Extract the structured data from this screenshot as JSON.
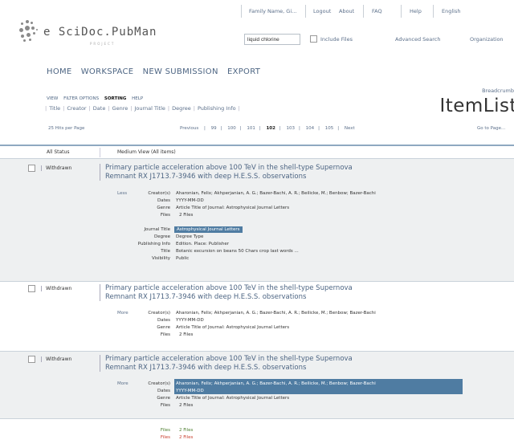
{
  "topbar": {
    "user": "Family Name, Gi...",
    "logout": "Logout",
    "about": "About",
    "faq": "FAQ",
    "help": "Help",
    "language": "English"
  },
  "logo": {
    "text": "e SciDoc.PubMan",
    "sub": "PROJECT"
  },
  "search": {
    "value": "liquid chlorine",
    "include_files": "Include Files",
    "advanced": "Advanced Search",
    "organization": "Organization"
  },
  "mainnav": [
    "HOME",
    "WORKSPACE",
    "NEW SUBMISSION",
    "EXPORT"
  ],
  "submenu": [
    {
      "label": "VIEW",
      "active": false
    },
    {
      "label": "FILTER OPTIONS",
      "active": false
    },
    {
      "label": "SORTING",
      "active": true
    },
    {
      "label": "HELP",
      "active": false
    }
  ],
  "sort_options": [
    "Title",
    "Creator",
    "Date",
    "Genre",
    "Journal Title",
    "Degree",
    "Publishing Info"
  ],
  "breadcrumb": "Breadcrumb",
  "page_title": "ItemList",
  "paging": {
    "hits": "25 Hits per Page",
    "previous": "Previous",
    "pages": [
      "99",
      "100",
      "101",
      "102",
      "103",
      "104",
      "105"
    ],
    "current": "102",
    "next": "Next",
    "goto": "Go to Page..."
  },
  "list_header": {
    "status": "All Status",
    "view": "Medium View (All items)"
  },
  "labels": {
    "creators": "Creator(s)",
    "dates": "Dates",
    "genre": "Genre",
    "files": "Files",
    "journal_title": "Journal Title",
    "degree": "Degree",
    "publishing_info": "Publishing Info",
    "title": "Title",
    "visibility": "Visibility"
  },
  "items": [
    {
      "status": "Withdrawn",
      "title_line1": "Primary particle acceleration above 100 TeV in the shell-type Supernova",
      "title_line2": "Remnant RX J1713.7-3946 with deep H.E.S.S. observations",
      "toggle": "Less",
      "creators": "Aharonian, Felix; Akhperjanian, A. G.; Bazer-Bachi, A. R.; Beilicke, M.; Benbow; Bazer-Bachi",
      "dates": "YYYY-MM-DD",
      "genre": "Article Title of Journal: Astrophysical Journal Letters",
      "files": "2 Files",
      "journal_title": "Astrophysical Journal Letters",
      "degree": "Degree Type",
      "publishing_info": "Edition. Place: Publisher",
      "title": "Botanic excursion on beans 50 Chars crop last words ...",
      "visibility": "Public"
    },
    {
      "status": "Withdrawn",
      "title_line1": "Primary particle acceleration above 100 TeV in the shell-type Supernova",
      "title_line2": "Remnant RX J1713.7-3946 with deep H.E.S.S. observations",
      "toggle": "More",
      "creators": "Aharonian, Felix; Akhperjanian, A. G.; Bazer-Bachi, A. R.; Beilicke, M.; Benbow; Bazer-Bachi",
      "dates": "YYYY-MM-DD",
      "genre": "Article Title of Journal: Astrophysical Journal Letters",
      "files": "2 Files"
    },
    {
      "status": "Withdrawn",
      "title_line1": "Primary particle acceleration above 100 TeV in the shell-type Supernova",
      "title_line2": "Remnant RX J1713.7-3946 with deep H.E.S.S. observations",
      "toggle": "More",
      "creators_line1": "Aharonian, Felix; Akhperjanian, A. G.; Bazer-Bachi, A. R.; Beilicke, M.; Benbow; Bazer-Bachi",
      "creators_line2": "YYYY-MM-DD",
      "genre": "Article Title of Journal: Astrophysical Journal Letters",
      "files": "2 Files"
    }
  ],
  "footer_files": [
    {
      "label": "Files",
      "value": "2 Files",
      "color": "#4d7e2f"
    },
    {
      "label": "Files",
      "value": "2 Files",
      "color": "#c94030"
    }
  ]
}
